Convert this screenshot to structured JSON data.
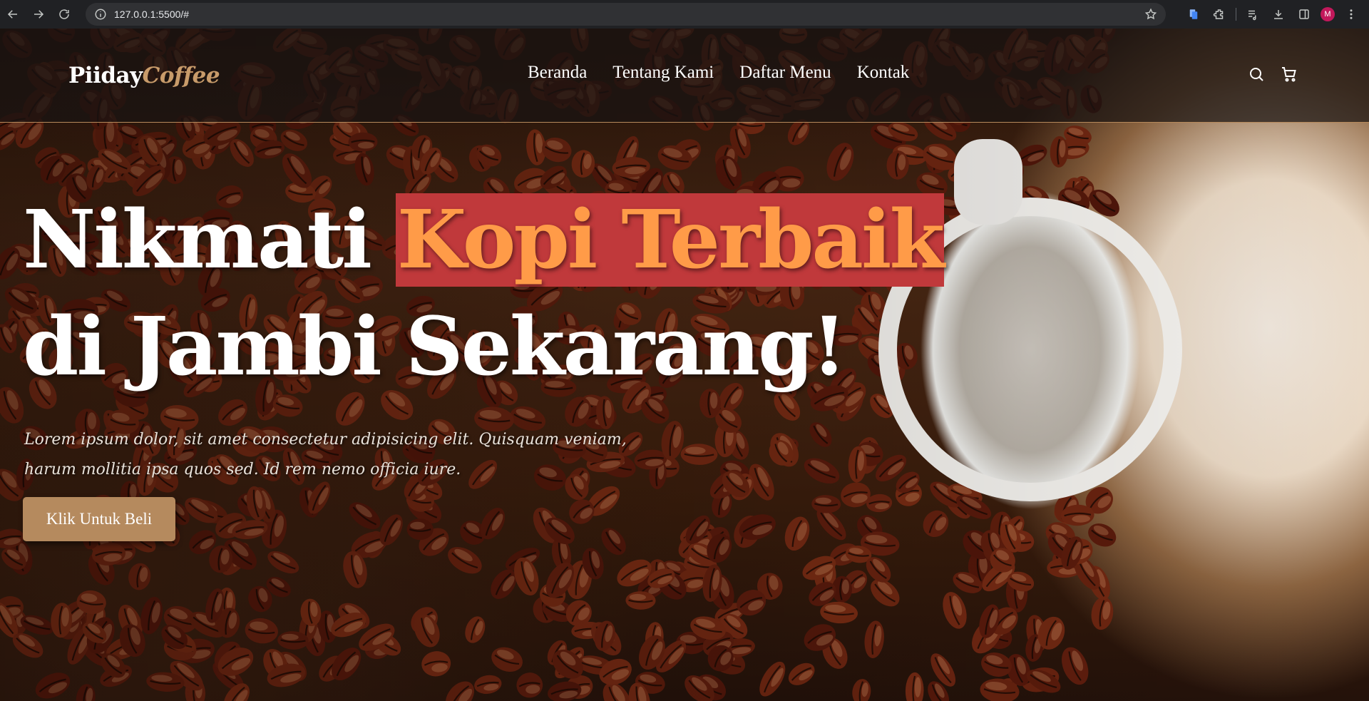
{
  "browser": {
    "url": "127.0.0.1:5500/#",
    "profile_initial": "M",
    "icons": [
      "back-icon",
      "forward-icon",
      "reload-icon",
      "site-info-icon",
      "bookmark-star-icon",
      "extension-icon",
      "puzzle-icon",
      "media-icon",
      "download-icon",
      "sidepanel-icon",
      "menu-dots-icon"
    ]
  },
  "navbar": {
    "brand": {
      "primary": "Piiday",
      "accent": "Coffee"
    },
    "menu": [
      {
        "label": "Beranda"
      },
      {
        "label": "Tentang Kami"
      },
      {
        "label": "Daftar Menu"
      },
      {
        "label": "Kontak"
      }
    ],
    "icons": [
      "search-icon",
      "cart-icon"
    ]
  },
  "hero": {
    "title_part1": "Nikmati ",
    "title_highlight": "Kopi Terbaik",
    "title_line2": "di Jambi Sekarang!",
    "description": "Lorem ipsum dolor, sit amet consectetur adipisicing elit. Quisquam veniam, harum mollitia ipsa quos sed. Id rem nemo officia iure.",
    "cta_label": "Klik Untuk Beli"
  },
  "colors": {
    "accent": "#b58a5e",
    "highlight_bg": "#c0393b",
    "highlight_text": "#ff9b48",
    "brand_accent": "#c89b6a"
  }
}
